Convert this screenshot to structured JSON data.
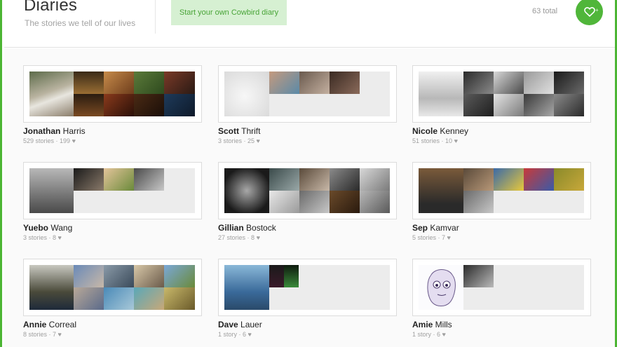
{
  "header": {
    "title": "Diaries",
    "subtitle": "The stories we tell of our lives",
    "start_button": "Start your own Cowbird diary",
    "total": "63 total",
    "heart_icon": "heart-outline-icon",
    "plus": "+"
  },
  "colors": {
    "accent": "#4cb534",
    "button_bg": "#d6f0d2",
    "button_text": "#48a437"
  },
  "diaries": [
    {
      "first": "Jonathan",
      "last": " Harris",
      "stories": "529 stories",
      "loves": "199"
    },
    {
      "first": "Scott",
      "last": " Thrift",
      "stories": "3 stories",
      "loves": "25"
    },
    {
      "first": "Nicole",
      "last": " Kenney",
      "stories": "51 stories",
      "loves": "10"
    },
    {
      "first": "Yuebo",
      "last": " Wang",
      "stories": "3 stories",
      "loves": "8"
    },
    {
      "first": "Gillian",
      "last": " Bostock",
      "stories": "27 stories",
      "loves": "8"
    },
    {
      "first": "Sep",
      "last": " Kamvar",
      "stories": "5 stories",
      "loves": "7"
    },
    {
      "first": "Annie",
      "last": " Correal",
      "stories": "8 stories",
      "loves": "7"
    },
    {
      "first": "Dave",
      "last": " Lauer",
      "stories": "1 story",
      "loves": "6"
    },
    {
      "first": "Amie",
      "last": " Mills",
      "stories": "1 story",
      "loves": "6"
    }
  ]
}
